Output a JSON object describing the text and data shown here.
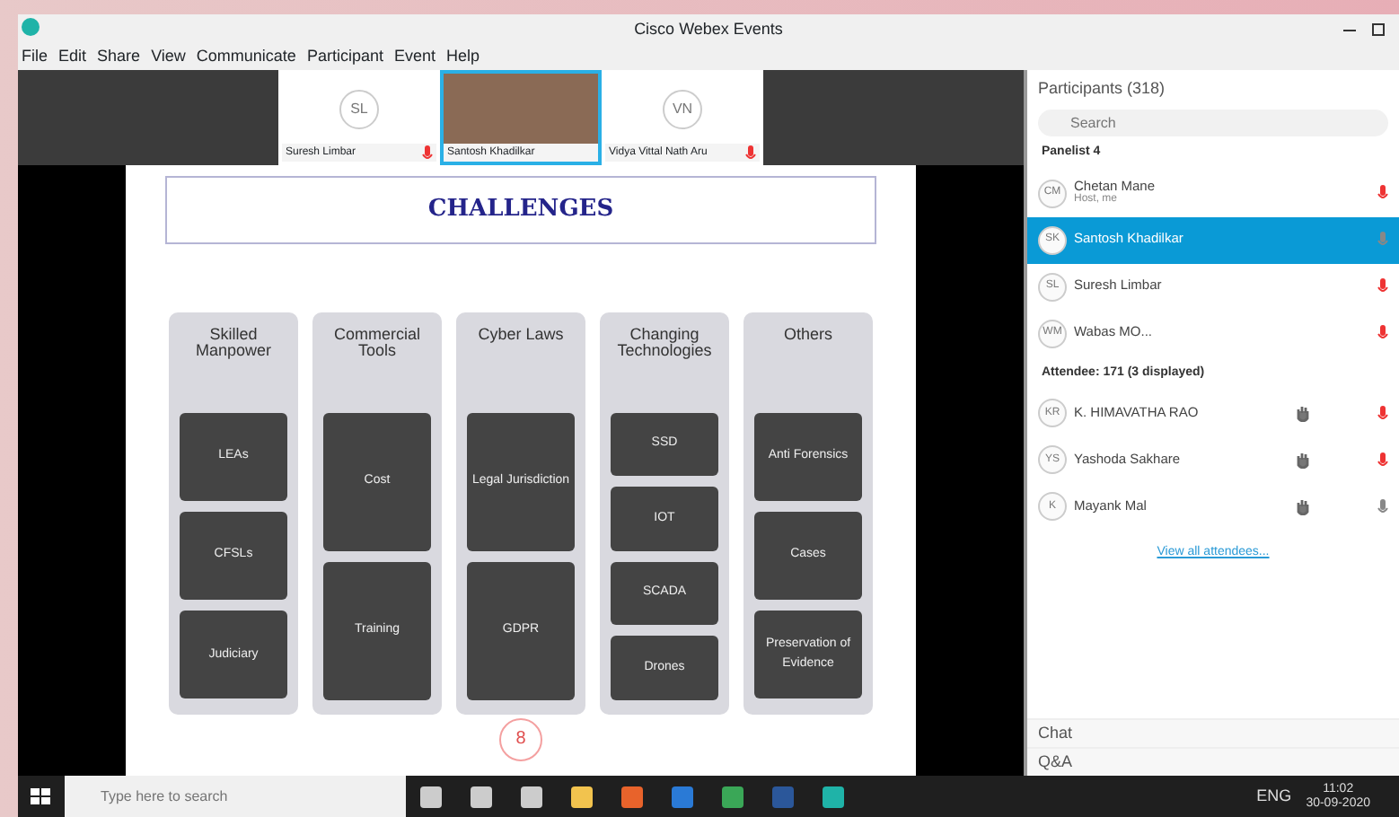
{
  "window": {
    "title": "Cisco Webex Events"
  },
  "menu": [
    "File",
    "Edit",
    "Share",
    "View",
    "Communicate",
    "Participant",
    "Event",
    "Help"
  ],
  "videos": [
    {
      "kind": "initials",
      "initials": "SL",
      "name": "Suresh Limbar",
      "muted": true,
      "selected": false
    },
    {
      "kind": "photo",
      "name": "Santosh Khadilkar",
      "muted": false,
      "selected": true
    },
    {
      "kind": "initials",
      "initials": "VN",
      "name": "Vidya Vittal Nath Aru",
      "muted": true,
      "selected": false
    }
  ],
  "slide": {
    "title": "CHALLENGES",
    "page": "8",
    "columns": [
      {
        "heading": "Skilled Manpower",
        "items": [
          "LEAs",
          "CFSLs",
          "Judiciary"
        ]
      },
      {
        "heading": "Commercial Tools",
        "items": [
          "Cost",
          "Training"
        ]
      },
      {
        "heading": "Cyber Laws",
        "items": [
          "Legal Jurisdiction",
          "GDPR"
        ]
      },
      {
        "heading": "Changing Technologies",
        "items": [
          "SSD",
          "IOT",
          "SCADA",
          "Drones"
        ]
      },
      {
        "heading": "Others",
        "items": [
          "Anti Forensics",
          "Cases",
          "Preservation of Evidence"
        ]
      }
    ]
  },
  "participants": {
    "title": "Participants (318)",
    "search": {
      "placeholder": "Search"
    },
    "groups": [
      {
        "label": "Panelist 4",
        "members": [
          {
            "initials": "CM",
            "name": "Chetan Mane",
            "subtitle": "Host, me",
            "selected": false,
            "hand": false,
            "muted": true
          },
          {
            "initials": "SK",
            "name": "Santosh Khadilkar",
            "selected": true,
            "hand": false,
            "muted": false
          },
          {
            "initials": "SL",
            "name": "Suresh Limbar",
            "selected": false,
            "hand": false,
            "muted": true
          },
          {
            "initials": "WM",
            "name": "Wabas MO...",
            "selected": false,
            "hand": false,
            "muted": true
          }
        ]
      },
      {
        "label": "Attendee: 171 (3 displayed)",
        "members": [
          {
            "initials": "KR",
            "name": "K. HIMAVATHA RAO",
            "selected": false,
            "hand": true,
            "muted": true
          },
          {
            "initials": "YS",
            "name": "Yashoda Sakhare",
            "selected": false,
            "hand": true,
            "muted": true
          },
          {
            "initials": "K",
            "name": "Mayank Mal",
            "selected": false,
            "hand": true,
            "muted": false
          }
        ]
      }
    ],
    "link": "View all attendees...",
    "sections": [
      "Chat",
      "Q&A"
    ]
  },
  "taskbar": {
    "search": {
      "placeholder": "Type here to search"
    },
    "language": "ENG",
    "time": "11:02",
    "date": "30-09-2020"
  }
}
